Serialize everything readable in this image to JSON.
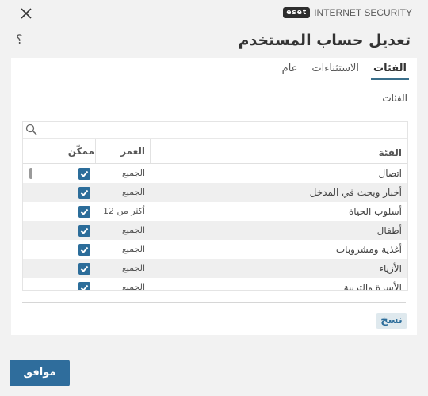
{
  "brand": {
    "logo_text": "eset",
    "product": "INTERNET SECURITY"
  },
  "page": {
    "title": "تعديل حساب المستخدم",
    "help": "؟"
  },
  "tabs": [
    {
      "label": "عام",
      "active": false
    },
    {
      "label": "الاستثناءات",
      "active": false
    },
    {
      "label": "الفئات",
      "active": true
    }
  ],
  "section_label": "الفئات",
  "search": {
    "value": "",
    "placeholder": ""
  },
  "table": {
    "headers": {
      "category": "الفئة",
      "age": "العمر",
      "enabled": "ممكّن"
    },
    "rows": [
      {
        "category": "اتصال",
        "age": "الجميع",
        "enabled": true
      },
      {
        "category": "أخبار وبحث في المدخل",
        "age": "الجميع",
        "enabled": true
      },
      {
        "category": "أسلوب الحياة",
        "age": "أكثر من 12",
        "enabled": true
      },
      {
        "category": "أطفال",
        "age": "الجميع",
        "enabled": true
      },
      {
        "category": "أغذية ومشروبات",
        "age": "الجميع",
        "enabled": true
      },
      {
        "category": "الأزياء",
        "age": "الجميع",
        "enabled": true
      },
      {
        "category": "الأسرة والتربية",
        "age": "الجميع",
        "enabled": true
      }
    ]
  },
  "buttons": {
    "copy": "نسخ",
    "ok": "موافق"
  },
  "colors": {
    "accent": "#2c6d9a",
    "background": "#f2f2f2",
    "panel": "#ffffff"
  }
}
